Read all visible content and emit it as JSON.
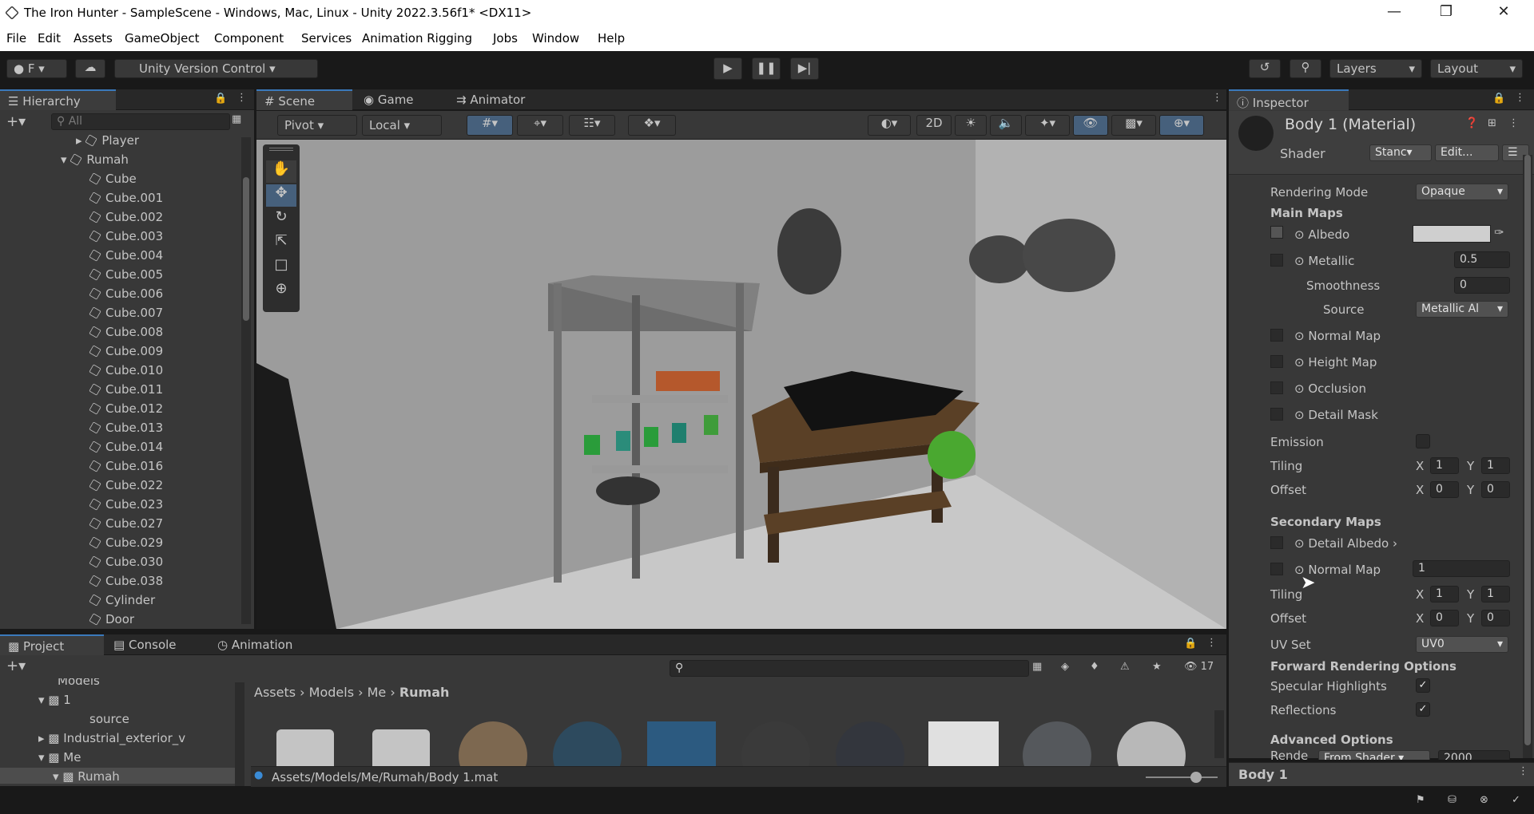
{
  "window": {
    "title": "The Iron Hunter - SampleScene - Windows, Mac, Linux - Unity 2022.3.56f1* <DX11>"
  },
  "menu": [
    "File",
    "Edit",
    "Assets",
    "GameObject",
    "Component",
    "Services",
    "Animation Rigging",
    "Jobs",
    "Window",
    "Help"
  ],
  "toolbar": {
    "account": "F",
    "version_control": "Unity Version Control",
    "layers": "Layers",
    "layout": "Layout"
  },
  "hierarchy": {
    "tab": "Hierarchy",
    "search_placeholder": "All",
    "items": [
      "Player",
      "Rumah",
      "Cube",
      "Cube.001",
      "Cube.002",
      "Cube.003",
      "Cube.004",
      "Cube.005",
      "Cube.006",
      "Cube.007",
      "Cube.008",
      "Cube.009",
      "Cube.010",
      "Cube.011",
      "Cube.012",
      "Cube.013",
      "Cube.014",
      "Cube.016",
      "Cube.022",
      "Cube.023",
      "Cube.027",
      "Cube.029",
      "Cube.030",
      "Cube.038",
      "Cylinder",
      "Door"
    ]
  },
  "scene": {
    "tabs": [
      "Scene",
      "Game",
      "Animator"
    ],
    "pivot": "Pivot",
    "local": "Local",
    "mode2d": "2D"
  },
  "inspector": {
    "tab": "Inspector",
    "title": "Body 1 (Material)",
    "shader_label": "Shader",
    "shader_value": "Stanc",
    "edit_button": "Edit...",
    "rendering_mode_label": "Rendering Mode",
    "rendering_mode": "Opaque",
    "main_maps": "Main Maps",
    "albedo": "Albedo",
    "metallic": "Metallic",
    "metallic_value": "0.5",
    "smoothness": "Smoothness",
    "smoothness_value": "0",
    "source": "Source",
    "source_value": "Metallic Al",
    "normal_map": "Normal Map",
    "height_map": "Height Map",
    "occlusion": "Occlusion",
    "detail_mask": "Detail Mask",
    "emission": "Emission",
    "tiling": "Tiling",
    "offset": "Offset",
    "tiling_x": "1",
    "tiling_y": "1",
    "offset_x": "0",
    "offset_y": "0",
    "secondary_maps": "Secondary Maps",
    "detail_albedo": "Detail Albedo",
    "normal_map2": "Normal Map",
    "normal_map2_value": "1",
    "tiling2_x": "1",
    "tiling2_y": "1",
    "offset2_x": "0",
    "offset2_y": "0",
    "uv_set": "UV Set",
    "uv_set_value": "UV0",
    "forward_options": "Forward Rendering Options",
    "specular": "Specular Highlights",
    "reflections": "Reflections",
    "advanced": "Advanced Options",
    "render_queue_label": "Rende",
    "render_queue_mode": "From Shader",
    "render_queue_value": "2000",
    "footer": "Body 1",
    "x": "X",
    "y": "Y"
  },
  "project": {
    "tabs": [
      "Project",
      "Console",
      "Animation"
    ],
    "tree": [
      "Models",
      "1",
      "source",
      "Industrial_exterior_v",
      "Me",
      "Rumah"
    ],
    "breadcrumb": [
      "Assets",
      "Models",
      "Me",
      "Rumah"
    ],
    "count": "17",
    "path": "Assets/Models/Me/Rumah/Body 1.mat"
  }
}
